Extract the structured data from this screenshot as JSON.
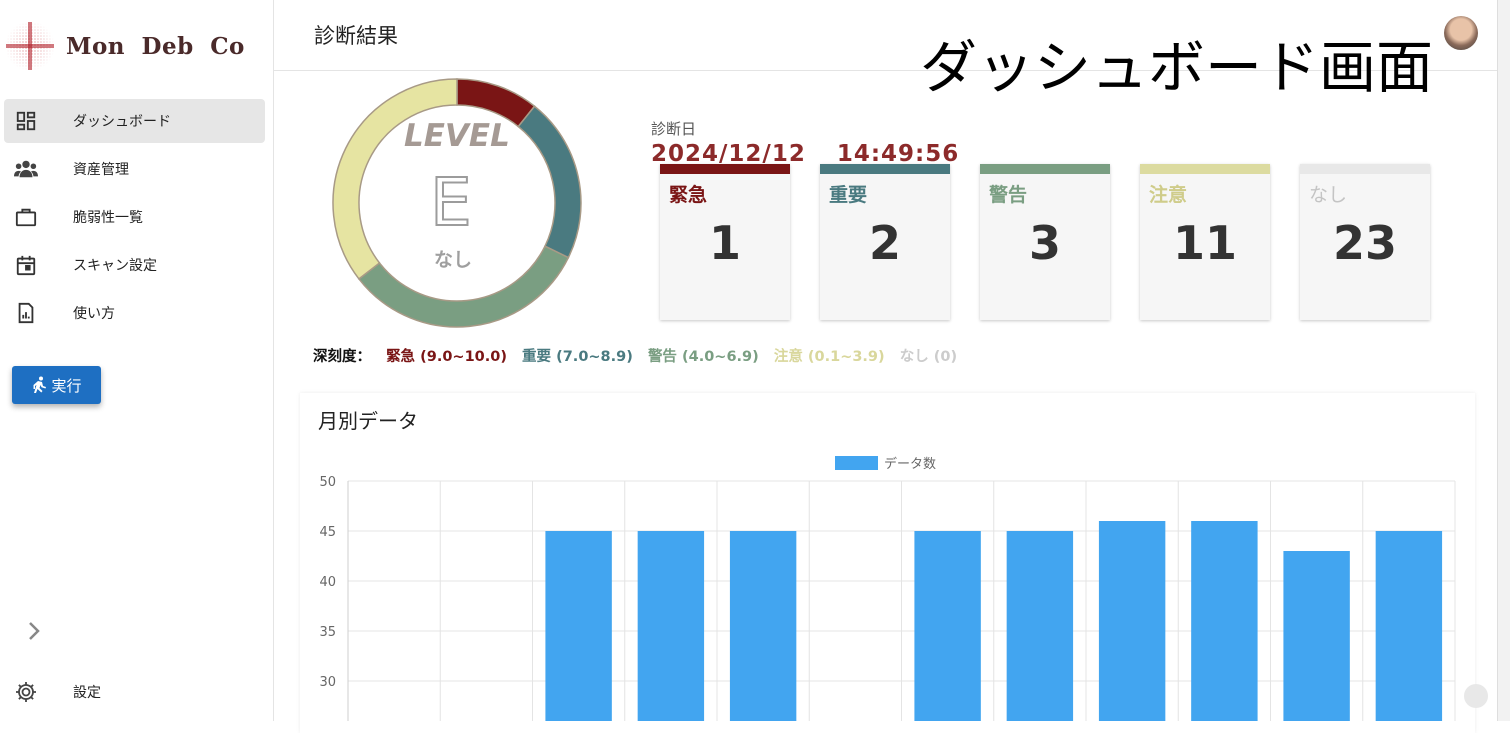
{
  "app": {
    "brand": "Mon Deb Co"
  },
  "sidebar": {
    "items": [
      {
        "label": "ダッシュボード",
        "icon": "dashboard-icon",
        "active": true
      },
      {
        "label": "資産管理",
        "icon": "people-icon"
      },
      {
        "label": "脆弱性一覧",
        "icon": "briefcase-icon"
      },
      {
        "label": "スキャン設定",
        "icon": "calendar-icon"
      },
      {
        "label": "使い方",
        "icon": "report-icon"
      }
    ],
    "run_button": "実行",
    "settings_label": "設定"
  },
  "header": {
    "title": "診断結果",
    "overlay_title": "ダッシュボード画面"
  },
  "gauge": {
    "level_label": "LEVEL",
    "grade": "E",
    "grade_sub": "なし",
    "segments": [
      {
        "name": "緊急",
        "value": 1,
        "color": "#7a1515"
      },
      {
        "name": "重要",
        "value": 2,
        "color": "#4a7a80"
      },
      {
        "name": "警告",
        "value": 3,
        "color": "#7a9e82"
      },
      {
        "name": "注意",
        "value": 3.3,
        "color": "#e6e4a2"
      }
    ]
  },
  "diagnosis": {
    "date_label": "診断日",
    "date": "2024/12/12",
    "time": "14:49:56"
  },
  "severity_cards": [
    {
      "label": "緊急",
      "count": "1",
      "bar_color": "#7a1515",
      "text_color": "#7a1515"
    },
    {
      "label": "重要",
      "count": "2",
      "bar_color": "#4a7a80",
      "text_color": "#4a7a80"
    },
    {
      "label": "警告",
      "count": "3",
      "bar_color": "#7a9e82",
      "text_color": "#7a9e82"
    },
    {
      "label": "注意",
      "count": "11",
      "bar_color": "#dcdba0",
      "text_color": "#cfcc8a"
    },
    {
      "label": "なし",
      "count": "23",
      "bar_color": "#e8e8e8",
      "text_color": "#c4c4c4"
    }
  ],
  "severity_legend": {
    "label": "深刻度：",
    "items": [
      {
        "text": "緊急 (9.0~10.0)",
        "color": "#7a1515"
      },
      {
        "text": "重要 (7.0~8.9)",
        "color": "#4a7a80"
      },
      {
        "text": "警告 (4.0~6.9)",
        "color": "#7a9e82"
      },
      {
        "text": "注意 (0.1~3.9)",
        "color": "#d9d79c"
      },
      {
        "text": "なし (0)",
        "color": "#cccccc"
      }
    ]
  },
  "chart_data": {
    "type": "bar",
    "title": "月別データ",
    "legend": [
      "データ数"
    ],
    "series": [
      {
        "name": "データ数",
        "values": [
          null,
          null,
          45,
          45,
          45,
          null,
          45,
          45,
          46,
          46,
          43,
          45
        ],
        "color": "#42a5f0"
      }
    ],
    "yticks": [
      50,
      45,
      40,
      35,
      30
    ],
    "ylim": [
      30,
      50
    ],
    "grid": true
  }
}
